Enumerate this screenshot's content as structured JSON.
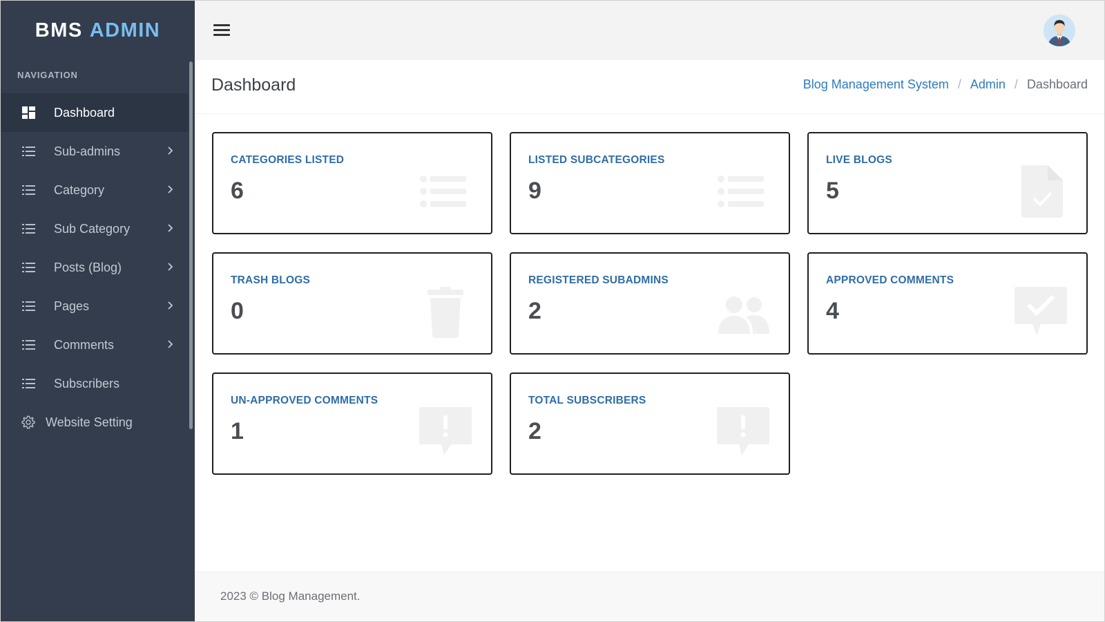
{
  "brand": {
    "part1": "BMS",
    "part2": "ADMIN"
  },
  "sidebar": {
    "nav_title": "NAVIGATION",
    "items": [
      {
        "label": "Dashboard",
        "icon": "dashboard-icon",
        "active": true
      },
      {
        "label": "Sub-admins",
        "icon": "list-icon",
        "has_submenu": true
      },
      {
        "label": "Category",
        "icon": "list-icon",
        "has_submenu": true
      },
      {
        "label": "Sub Category",
        "icon": "list-icon",
        "has_submenu": true
      },
      {
        "label": "Posts (Blog)",
        "icon": "list-icon",
        "has_submenu": true
      },
      {
        "label": "Pages",
        "icon": "list-icon",
        "has_submenu": true
      },
      {
        "label": "Comments",
        "icon": "list-icon",
        "has_submenu": true
      },
      {
        "label": "Subscribers",
        "icon": "list-icon"
      },
      {
        "label": "Website Setting",
        "icon": "gear-icon"
      }
    ]
  },
  "topbar": {
    "menu_icon": "hamburger-icon",
    "avatar_icon": "user-avatar"
  },
  "page": {
    "title": "Dashboard",
    "breadcrumb": [
      "Blog Management System",
      "Admin",
      "Dashboard"
    ],
    "breadcrumb_separator": "/"
  },
  "cards": [
    {
      "title": "CATEGORIES LISTED",
      "value": "6",
      "icon": "list-icon"
    },
    {
      "title": "LISTED SUBCATEGORIES",
      "value": "9",
      "icon": "list-icon"
    },
    {
      "title": "LIVE BLOGS",
      "value": "5",
      "icon": "file-check-icon"
    },
    {
      "title": "TRASH BLOGS",
      "value": "0",
      "icon": "trash-icon"
    },
    {
      "title": "REGISTERED SUBADMINS",
      "value": "2",
      "icon": "users-icon"
    },
    {
      "title": "APPROVED COMMENTS",
      "value": "4",
      "icon": "comment-check-icon"
    },
    {
      "title": "UN-APPROVED COMMENTS",
      "value": "1",
      "icon": "comment-alert-icon"
    },
    {
      "title": "TOTAL SUBSCRIBERS",
      "value": "2",
      "icon": "comment-alert-icon"
    }
  ],
  "footer": {
    "text": "2023 © Blog Management."
  },
  "colors": {
    "sidebar_bg": "#333d4d",
    "sidebar_active_bg": "#2c3544",
    "brand_accent": "#79bdf0",
    "link": "#2e7bbf",
    "card_title": "#2f6da6",
    "card_icon": "#f0f0f0"
  }
}
